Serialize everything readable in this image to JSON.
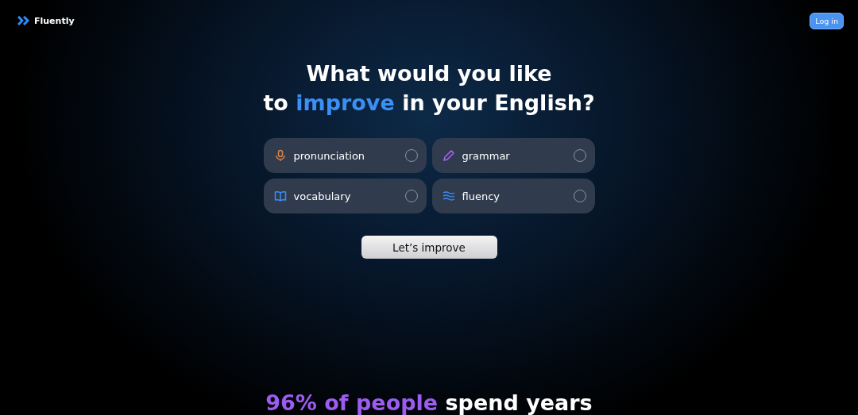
{
  "header": {
    "logo": "Fluently",
    "login_button": "Log in"
  },
  "heading": {
    "lines": [
      [
        {
          "text": "What would you like",
          "highlight": false
        }
      ],
      [
        {
          "text": "to ",
          "highlight": false
        },
        {
          "text": "improve",
          "highlight": true
        },
        {
          "text": " in your English?",
          "highlight": false
        }
      ]
    ]
  },
  "options": [
    {
      "label": "pronunciation",
      "kind": "microphone",
      "selected": false
    },
    {
      "label": "grammar",
      "kind": "pen",
      "selected": false
    },
    {
      "label": "vocabulary",
      "kind": "book",
      "selected": false
    },
    {
      "label": "fluency",
      "kind": "waves",
      "selected": false
    }
  ],
  "cta_button": "Let’s improve",
  "next_heading": [
    {
      "text": "96% of people",
      "highlight": true
    },
    {
      "text": " spend years",
      "highlight": false
    }
  ]
}
